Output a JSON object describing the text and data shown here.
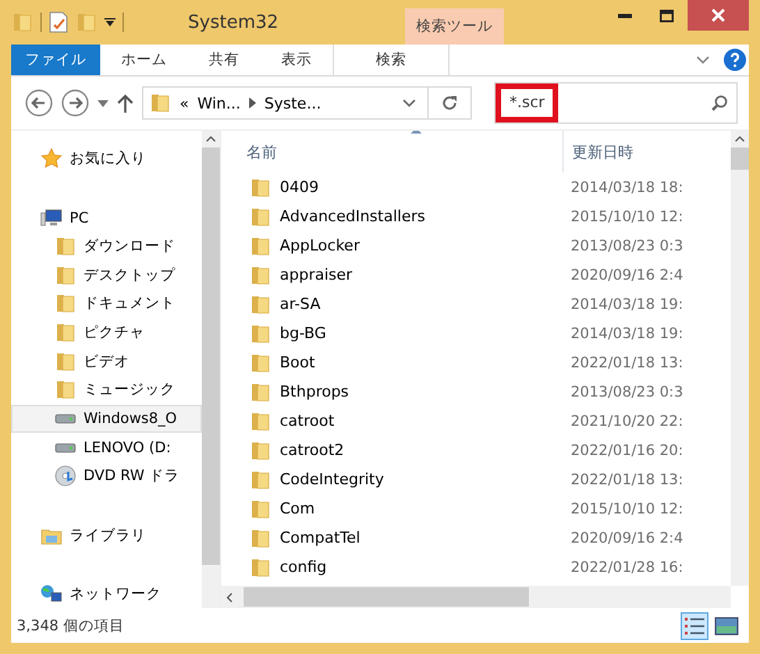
{
  "window": {
    "title": "System32",
    "context_tab_group": "検索ツール"
  },
  "ribbon_tabs": [
    {
      "label": "ファイル",
      "kind": "file"
    },
    {
      "label": "ホーム",
      "kind": "normal"
    },
    {
      "label": "共有",
      "kind": "normal"
    },
    {
      "label": "表示",
      "kind": "normal"
    },
    {
      "label": "検索",
      "kind": "contextual"
    }
  ],
  "address_bar": {
    "breadcrumb_overflow": "«",
    "segments": [
      "Win...",
      "Syste..."
    ]
  },
  "search": {
    "value": "*.scr",
    "highlighted": true
  },
  "sidebar": {
    "items": [
      {
        "label": "お気に入り",
        "kind": "star",
        "selected": false
      },
      {
        "label": "PC",
        "kind": "pc",
        "selected": false,
        "children": [
          {
            "label": "ダウンロード",
            "kind": "folder",
            "selected": false
          },
          {
            "label": "デスクトップ",
            "kind": "folder",
            "selected": false
          },
          {
            "label": "ドキュメント",
            "kind": "folder",
            "selected": false
          },
          {
            "label": "ピクチャ",
            "kind": "folder",
            "selected": false
          },
          {
            "label": "ビデオ",
            "kind": "folder",
            "selected": false
          },
          {
            "label": "ミュージック",
            "kind": "folder",
            "selected": false
          },
          {
            "label": "Windows8_O",
            "kind": "drive",
            "selected": true
          },
          {
            "label": "LENOVO (D:",
            "kind": "drive",
            "selected": false
          },
          {
            "label": "DVD RW ドラ",
            "kind": "disc",
            "selected": false
          }
        ]
      },
      {
        "label": "ライブラリ",
        "kind": "library",
        "selected": false
      },
      {
        "label": "ネットワーク",
        "kind": "network",
        "selected": false
      }
    ]
  },
  "table": {
    "columns": [
      "名前",
      "更新日時"
    ],
    "rows": [
      {
        "name": "0409",
        "modified": "2014/03/18 18:"
      },
      {
        "name": "AdvancedInstallers",
        "modified": "2015/10/10 12:"
      },
      {
        "name": "AppLocker",
        "modified": "2013/08/23 0:3"
      },
      {
        "name": "appraiser",
        "modified": "2020/09/16 2:4"
      },
      {
        "name": "ar-SA",
        "modified": "2014/03/18 19:"
      },
      {
        "name": "bg-BG",
        "modified": "2014/03/18 19:"
      },
      {
        "name": "Boot",
        "modified": "2022/01/18 13:"
      },
      {
        "name": "Bthprops",
        "modified": "2013/08/23 0:3"
      },
      {
        "name": "catroot",
        "modified": "2021/10/20 22:"
      },
      {
        "name": "catroot2",
        "modified": "2022/01/16 20:"
      },
      {
        "name": "CodeIntegrity",
        "modified": "2022/01/18 13:"
      },
      {
        "name": "Com",
        "modified": "2015/10/10 12:"
      },
      {
        "name": "CompatTel",
        "modified": "2020/09/16 2:4"
      },
      {
        "name": "config",
        "modified": "2022/01/28 16:"
      }
    ]
  },
  "status_bar": {
    "item_count": "3,348 個の項目"
  },
  "view_buttons": [
    {
      "kind": "details",
      "selected": true
    },
    {
      "kind": "large_icons",
      "selected": false
    }
  ]
}
